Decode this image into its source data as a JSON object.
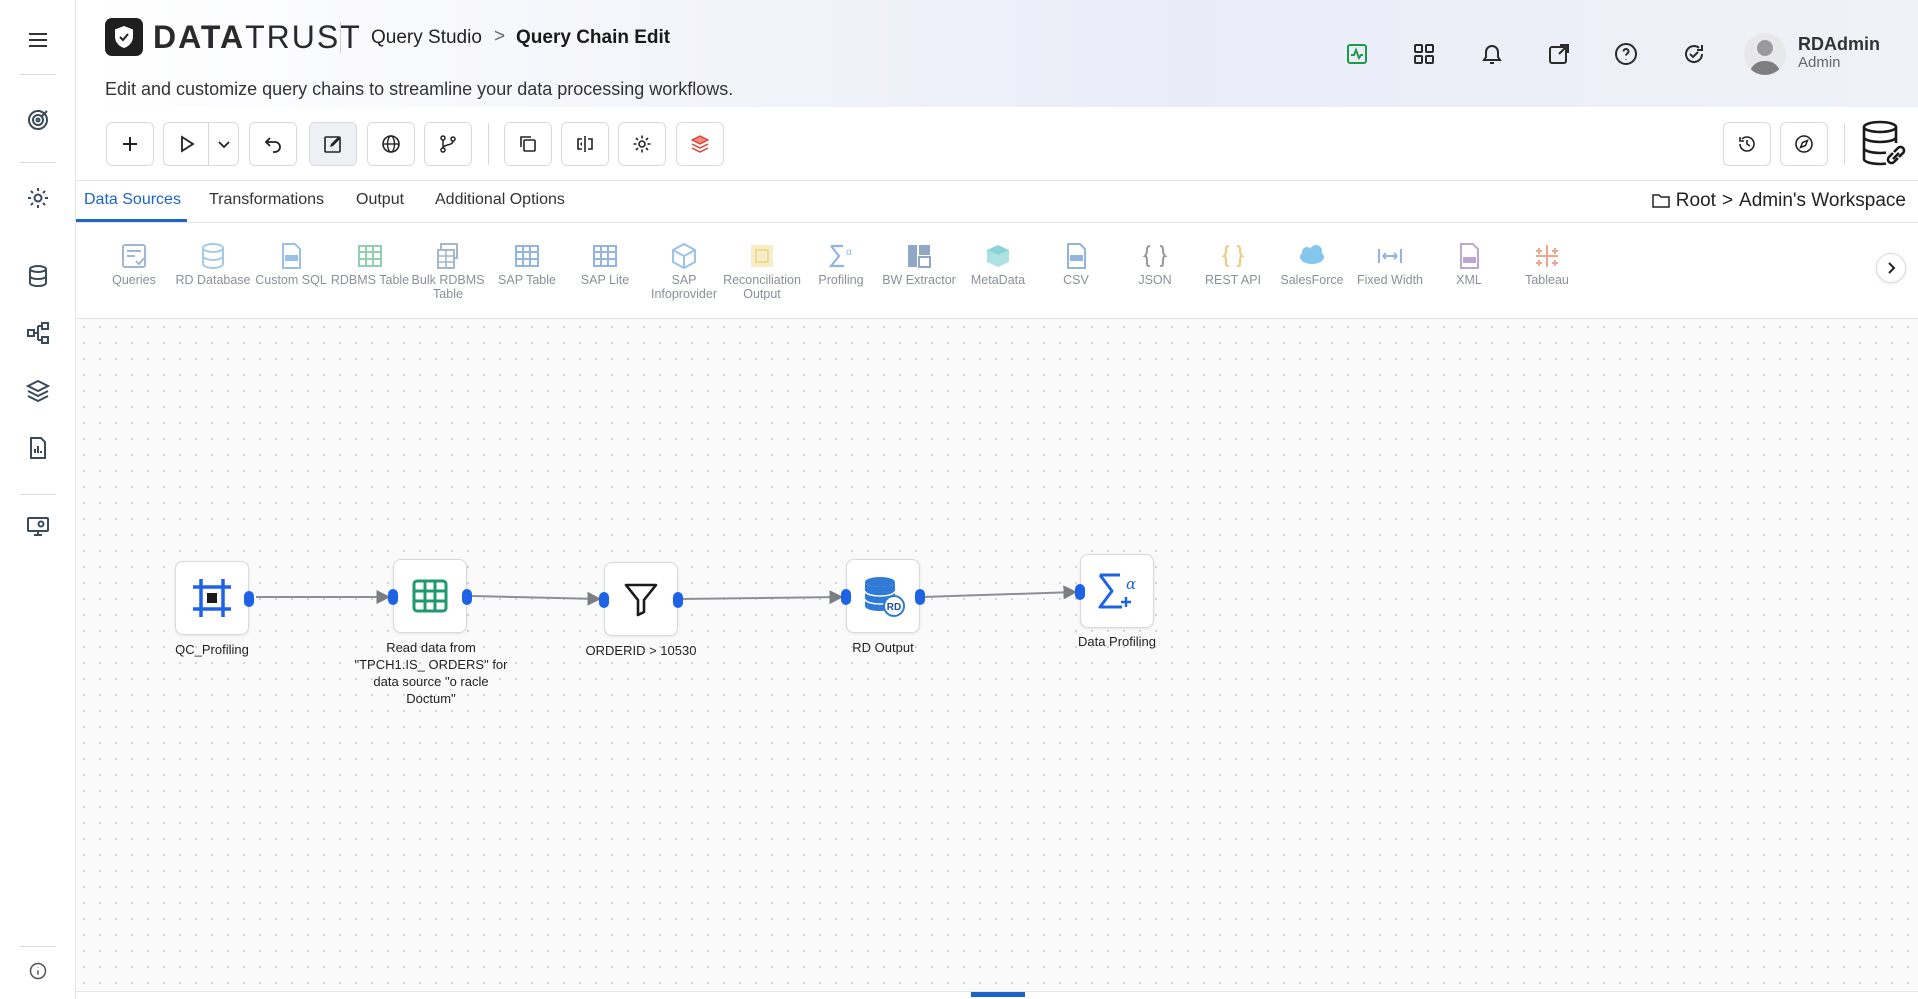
{
  "app": {
    "logo_text_bold": "DATA",
    "logo_text_light": "TRUST",
    "breadcrumb": {
      "parent": "Query Studio",
      "separator": ">",
      "current": "Query Chain Edit"
    },
    "subtitle": "Edit and customize query chains to streamline your data processing workflows."
  },
  "user": {
    "name": "RDAdmin",
    "role": "Admin"
  },
  "rail_icons": [
    "menu-icon",
    "target-icon",
    "settings-icon",
    "database-icon",
    "flow-icon",
    "layers-icon",
    "report-icon",
    "monitor-icon",
    "info-icon"
  ],
  "header_icons": [
    "activity-icon",
    "apps-grid-icon",
    "bell-icon",
    "external-link-icon",
    "help-icon",
    "refresh-check-icon"
  ],
  "toolbar": [
    "add-icon",
    "run-icon",
    "run-dropdown-icon",
    "undo-icon",
    "edit-icon",
    "globe-icon",
    "branch-icon",
    "copy-icon",
    "compare-icon",
    "gear-icon",
    "layers-stack-icon",
    "history-icon",
    "compass-icon",
    "database-link-icon"
  ],
  "tabs": [
    "Data Sources",
    "Transformations",
    "Output",
    "Additional Options"
  ],
  "active_tab": "Data Sources",
  "workspace_path": {
    "root": "Root",
    "sep": ">",
    "workspace": "Admin's Workspace"
  },
  "components": [
    {
      "label": "Queries",
      "icon": "queries-icon",
      "color": "#5a7ea8"
    },
    {
      "label": "RD Database",
      "icon": "rd-database-icon",
      "color": "#5a9fd4"
    },
    {
      "label": "Custom SQL",
      "icon": "custom-sql-icon",
      "color": "#4a90d9"
    },
    {
      "label": "RDBMS Table",
      "icon": "rdbms-table-icon",
      "color": "#3aa86b"
    },
    {
      "label": "Bulk RDBMS Table",
      "icon": "bulk-rdbms-table-icon",
      "color": "#5a7ea8"
    },
    {
      "label": "SAP Table",
      "icon": "sap-table-icon",
      "color": "#3a78c8"
    },
    {
      "label": "SAP Lite",
      "icon": "sap-lite-icon",
      "color": "#3a78c8"
    },
    {
      "label": "SAP Infoprovider",
      "icon": "sap-infoprovider-icon",
      "color": "#4a90d9"
    },
    {
      "label": "Reconciliation Output",
      "icon": "reconciliation-output-icon",
      "color": "#d9c23a"
    },
    {
      "label": "Profiling",
      "icon": "profiling-icon",
      "color": "#3a78c8"
    },
    {
      "label": "BW Extractor",
      "icon": "bw-extractor-icon",
      "color": "#3a5f9a"
    },
    {
      "label": "MetaData",
      "icon": "metadata-icon",
      "color": "#2ab3b3"
    },
    {
      "label": "CSV",
      "icon": "csv-icon",
      "color": "#3a78c8"
    },
    {
      "label": "JSON",
      "icon": "json-icon",
      "color": "#444444"
    },
    {
      "label": "REST API",
      "icon": "rest-api-icon",
      "color": "#e8a020"
    },
    {
      "label": "SalesForce",
      "icon": "salesforce-icon",
      "color": "#1e9be0"
    },
    {
      "label": "Fixed Width",
      "icon": "fixed-width-icon",
      "color": "#3a78c8"
    },
    {
      "label": "XML",
      "icon": "xml-icon",
      "color": "#8a5fb0"
    },
    {
      "label": "Tableau",
      "icon": "tableau-icon",
      "color": "#e06030"
    }
  ],
  "nodes": [
    {
      "id": "n1",
      "label": "QC_Profiling",
      "icon": "frame-icon"
    },
    {
      "id": "n2",
      "label": "Read data from \"TPCH1.IS_ ORDERS\" for data source \"o racle Doctum\"",
      "icon": "table-icon"
    },
    {
      "id": "n3",
      "label": "ORDERID > 10530",
      "icon": "filter-icon"
    },
    {
      "id": "n4",
      "label": "RD Output",
      "icon": "rd-output-icon"
    },
    {
      "id": "n5",
      "label": "Data Profiling",
      "icon": "data-profiling-icon"
    }
  ],
  "colors": {
    "accent": "#1e63c6",
    "port": "#1e63e6",
    "edge": "#8c8f95"
  }
}
